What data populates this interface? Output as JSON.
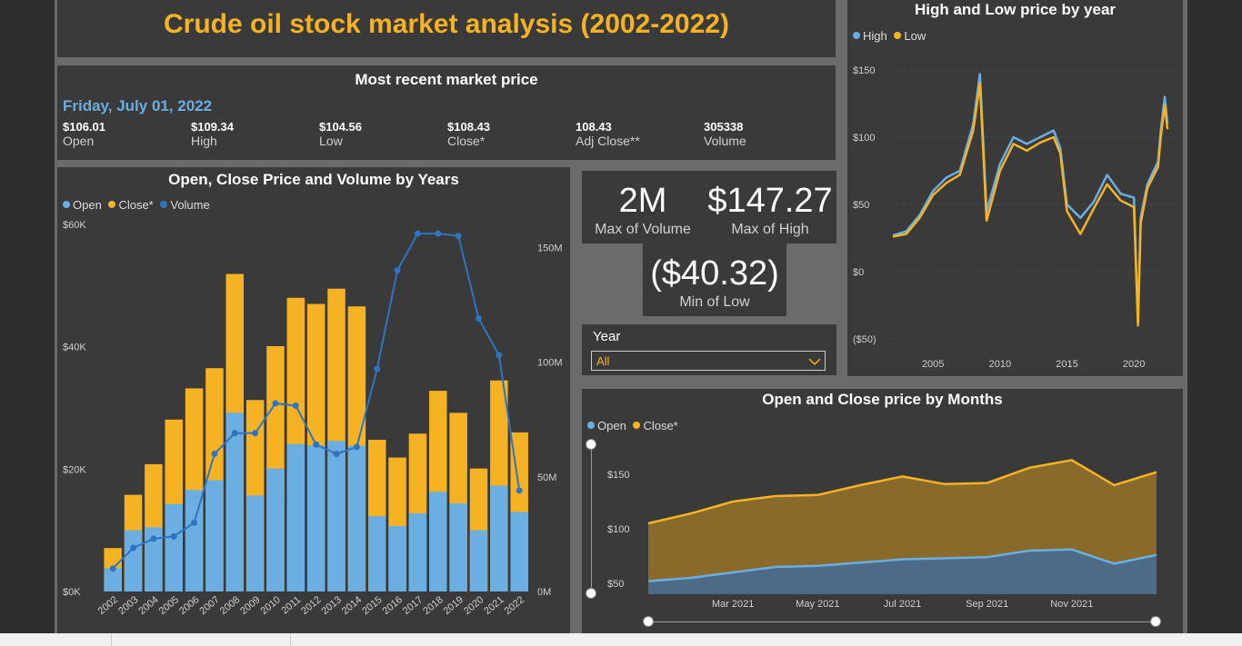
{
  "header": {
    "title": "Crude oil stock market analysis (2002-2022)"
  },
  "recent": {
    "title": "Most recent market price",
    "date": "Friday, July 01, 2022",
    "stats": [
      {
        "value": "$106.01",
        "label": "Open"
      },
      {
        "value": "$109.34",
        "label": "High"
      },
      {
        "value": "$104.56",
        "label": "Low"
      },
      {
        "value": "$108.43",
        "label": "Close*"
      },
      {
        "value": "108.43",
        "label": "Adj Close**"
      },
      {
        "value": "305338",
        "label": "Volume"
      }
    ]
  },
  "kpis": {
    "max_volume": {
      "value": "2M",
      "label": "Max of Volume"
    },
    "max_high": {
      "value": "$147.27",
      "label": "Max of High"
    },
    "min_low": {
      "value": "($40.32)",
      "label": "Min of Low"
    }
  },
  "filter": {
    "label": "Year",
    "value": "All"
  },
  "colors": {
    "open": "#6aaee2",
    "close": "#f5b324",
    "volume": "#2f74c0",
    "high": "#6aaee2",
    "low": "#f5b324",
    "title": "#f5b324"
  },
  "chart_data": [
    {
      "type": "bar",
      "title": "Open, Close Price and Volume by Years",
      "legend": [
        "Open",
        "Close*",
        "Volume"
      ],
      "legend_position": "top-left",
      "categories": [
        "2002",
        "2003",
        "2004",
        "2005",
        "2006",
        "2007",
        "2008",
        "2009",
        "2010",
        "2011",
        "2012",
        "2013",
        "2014",
        "2015",
        "2016",
        "2017",
        "2018",
        "2019",
        "2020",
        "2021",
        "2022"
      ],
      "series": [
        {
          "name": "Open",
          "values": [
            3800,
            10000,
            10500,
            14300,
            16600,
            18200,
            29200,
            15700,
            20100,
            24100,
            23900,
            24600,
            23800,
            12300,
            10700,
            12800,
            16300,
            14400,
            10000,
            17300,
            13000
          ]
        },
        {
          "name": "Close*",
          "values": [
            7100,
            15800,
            20800,
            28100,
            33200,
            36500,
            51900,
            31300,
            40100,
            48000,
            47000,
            49500,
            46600,
            24800,
            21900,
            25800,
            32800,
            29200,
            20100,
            34500,
            26000
          ]
        },
        {
          "name": "Volume",
          "values": [
            10,
            19,
            23,
            24,
            30,
            60,
            69,
            69,
            82,
            81,
            64,
            60,
            63,
            97,
            140,
            156,
            156,
            155,
            119,
            103,
            44
          ]
        }
      ],
      "ylim_left": [
        0,
        60000
      ],
      "yticks_left": [
        "$0K",
        "$20K",
        "$40K",
        "$60K"
      ],
      "ylim_right": [
        0,
        160
      ],
      "yticks_right": [
        "0M",
        "50M",
        "100M",
        "150M"
      ]
    },
    {
      "type": "line",
      "title": "High and Low price by year",
      "legend": [
        "High",
        "Low"
      ],
      "legend_position": "top-left",
      "x": [
        2002,
        2003,
        2004,
        2005,
        2006,
        2007,
        2008,
        2008.5,
        2009,
        2010,
        2011,
        2012,
        2013,
        2014,
        2014.5,
        2015,
        2016,
        2017,
        2018,
        2019,
        2020,
        2020.3,
        2020.5,
        2021,
        2021.8,
        2022,
        2022.3,
        2022.5
      ],
      "series": [
        {
          "name": "High",
          "values": [
            27,
            30,
            42,
            60,
            70,
            75,
            110,
            147,
            45,
            80,
            100,
            95,
            100,
            105,
            92,
            50,
            40,
            52,
            72,
            58,
            55,
            -38,
            40,
            65,
            82,
            105,
            130,
            110
          ]
        },
        {
          "name": "Low",
          "values": [
            26,
            28,
            40,
            57,
            66,
            72,
            105,
            140,
            38,
            75,
            95,
            90,
            96,
            100,
            88,
            45,
            28,
            47,
            65,
            53,
            48,
            -40,
            36,
            62,
            78,
            100,
            124,
            106
          ]
        }
      ],
      "ylim": [
        -50,
        150
      ],
      "yticks": [
        "($50)",
        "$0",
        "$50",
        "$100",
        "$150"
      ],
      "xticks": [
        "2005",
        "2010",
        "2015",
        "2020"
      ]
    },
    {
      "type": "area",
      "title": "Open and Close price by Months",
      "legend": [
        "Open",
        "Close*"
      ],
      "legend_position": "top-left",
      "x": [
        "Jan 2021",
        "Feb 2021",
        "Mar 2021",
        "Apr 2021",
        "May 2021",
        "Jun 2021",
        "Jul 2021",
        "Aug 2021",
        "Sep 2021",
        "Oct 2021",
        "Nov 2021",
        "Dec 2021",
        "Jan 2022"
      ],
      "series": [
        {
          "name": "Open",
          "values": [
            52,
            55,
            60,
            65,
            66,
            69,
            72,
            73,
            74,
            80,
            81,
            68,
            76
          ]
        },
        {
          "name": "Close*",
          "values": [
            105,
            114,
            125,
            130,
            131,
            140,
            148,
            141,
            142,
            156,
            163,
            140,
            152
          ]
        }
      ],
      "ylim": [
        40,
        170
      ],
      "yticks": [
        "$50",
        "$100",
        "$150"
      ],
      "xticks": [
        "Mar 2021",
        "May 2021",
        "Jul 2021",
        "Sep 2021",
        "Nov 2021"
      ]
    }
  ]
}
